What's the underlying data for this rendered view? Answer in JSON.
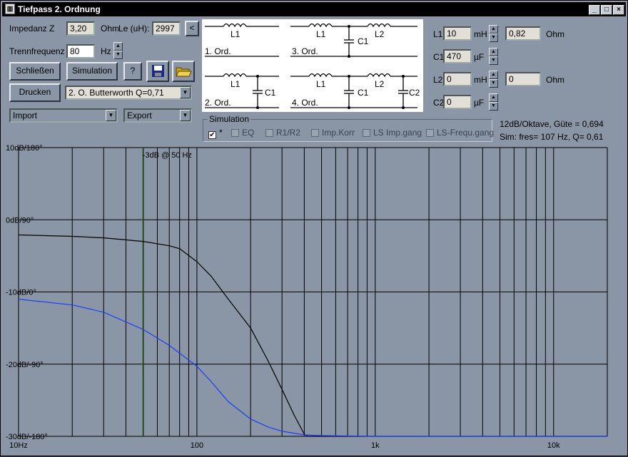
{
  "window": {
    "title": "Tiefpass 2. Ordnung"
  },
  "inputs": {
    "impedanz_label": "Impedanz Z",
    "impedanz_value": "3,20",
    "impedanz_unit": "Ohm",
    "le_label": "Le (uH):",
    "le_value": "2997",
    "le_button": "<",
    "trenn_label": "Trennfrequenz f",
    "trenn_value": "80",
    "trenn_unit": "Hz"
  },
  "buttons": {
    "schliessen": "Schließen",
    "simulation": "Simulation",
    "help": "?",
    "drucken": "Drucken"
  },
  "dropdowns": {
    "filter_type": "2. O. Butterworth Q=0,71",
    "import": "Import",
    "export": "Export"
  },
  "schematic": {
    "o1_l1": "L1",
    "o1_label": "1. Ord.",
    "o2_l1": "L1",
    "o2_c1": "C1",
    "o2_label": "2. Ord.",
    "o3_l1": "L1",
    "o3_l2": "L2",
    "o3_c1": "C1",
    "o3_label": "3. Ord.",
    "o4_l1": "L1",
    "o4_l2": "L2",
    "o4_c1": "C1",
    "o4_c2": "C2",
    "o4_label": "4. Ord."
  },
  "components": {
    "l1": {
      "label": "L1",
      "value": "10",
      "unit": "mH",
      "r_value": "0,82",
      "r_unit": "Ohm"
    },
    "c1": {
      "label": "C1",
      "value": "470",
      "unit": "µF"
    },
    "l2": {
      "label": "L2",
      "value": "0",
      "unit": "mH",
      "r_value": "0",
      "r_unit": "Ohm"
    },
    "c2": {
      "label": "C2",
      "value": "0",
      "unit": "µF"
    }
  },
  "simulation": {
    "group_label": "Simulation",
    "checkboxes": [
      {
        "label": "*",
        "checked": true
      },
      {
        "label": "EQ",
        "checked": false
      },
      {
        "label": "R1/R2",
        "checked": false
      },
      {
        "label": "Imp.Korr",
        "checked": false
      },
      {
        "label": "LS Imp.gang",
        "checked": false
      },
      {
        "label": "LS-Frequ.gang",
        "checked": false
      }
    ],
    "info_line1": "12dB/Oktave, Güte = 0,694",
    "info_line2": "Sim: fres= 107 Hz, Q= 0,61"
  },
  "chart_data": {
    "type": "line",
    "x_scale": "log",
    "xlim": [
      10,
      20000
    ],
    "ylim": [
      -30,
      10
    ],
    "x_ticks": [
      "10Hz",
      "100",
      "1k",
      "10k"
    ],
    "y_ticks": [
      "10dB/180°",
      "0dB/90°",
      "-10dB/0°",
      "-20dB/-90°",
      "-30dB/-180°"
    ],
    "marker": {
      "x": 50,
      "label": "-3dB @ 50 Hz",
      "color": "#1f4d1f"
    },
    "grid": true,
    "colors": {
      "background": "#8a95a5",
      "grid": "#000000"
    },
    "series": [
      {
        "color": "#000000",
        "x": [
          10,
          20,
          30,
          50,
          70,
          80,
          100,
          120,
          150,
          200,
          250,
          300,
          350,
          400,
          420,
          500,
          1000,
          20000
        ],
        "y": [
          -2.1,
          -2.3,
          -2.5,
          -3.0,
          -3.6,
          -4.0,
          -5.8,
          -7.8,
          -11.0,
          -15.0,
          -19.5,
          -23.5,
          -27.0,
          -29.7,
          -30,
          -30,
          -30,
          -30
        ]
      },
      {
        "color": "#1a3cff",
        "x": [
          10,
          20,
          30,
          50,
          70,
          100,
          120,
          150,
          200,
          250,
          300,
          400,
          500,
          700,
          1000,
          2000,
          5000,
          10000,
          20000
        ],
        "y": [
          -11.0,
          -11.8,
          -12.8,
          -15.2,
          -17.4,
          -20.3,
          -22.4,
          -25.2,
          -27.6,
          -28.7,
          -29.3,
          -29.8,
          -29.9,
          -29.95,
          -30,
          -30,
          -30,
          -30,
          -30
        ]
      }
    ]
  }
}
